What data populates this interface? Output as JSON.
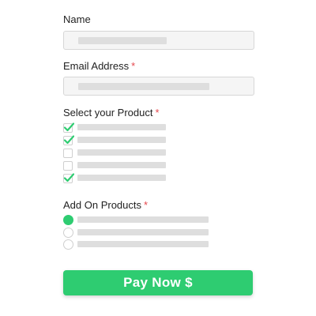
{
  "form": {
    "name": {
      "label": "Name",
      "required": false
    },
    "email": {
      "label": "Email Address",
      "required": true,
      "required_mark": "*"
    },
    "product": {
      "label": "Select your Product",
      "required_mark": "*",
      "options": [
        {
          "checked": true
        },
        {
          "checked": true
        },
        {
          "checked": false
        },
        {
          "checked": false
        },
        {
          "checked": true
        }
      ]
    },
    "addons": {
      "label": "Add On Products",
      "required_mark": "*",
      "options": [
        {
          "selected": true
        },
        {
          "selected": false
        },
        {
          "selected": false
        }
      ]
    },
    "submit_label": "Pay Now $"
  },
  "colors": {
    "accent": "#2ecc71",
    "required": "#e5484d",
    "placeholder_bar": "#dedede"
  }
}
